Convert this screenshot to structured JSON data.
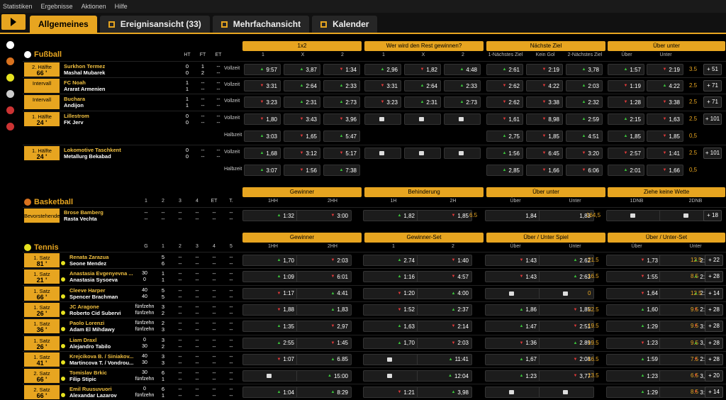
{
  "menu": [
    "Statistiken",
    "Ergebnisse",
    "Aktionen",
    "Hilfe"
  ],
  "tabs": [
    {
      "label": "Allgemeines",
      "active": true
    },
    {
      "label": "Ereignisansicht (33)"
    },
    {
      "label": "Mehrfachansicht"
    },
    {
      "label": "Kalender"
    }
  ],
  "football": {
    "title": "Fußball",
    "cols": [
      "HT",
      "FT",
      "ET"
    ],
    "markets": [
      "1x2",
      "Wer wird den Rest gewinnen?",
      "Nächste Ziel",
      "Über unter"
    ],
    "sub": [
      "1",
      "X",
      "2",
      "1",
      "X",
      "2",
      "1-Nächstes Ziel",
      "Kein Gol",
      "2-Nächstes Ziel",
      "Über",
      "Unter"
    ],
    "events": [
      {
        "s1": "2. Hälfte",
        "s2": "66 '",
        "h": "Surkhon Termez",
        "a": "Mashal Mubarek",
        "sc": [
          "0",
          "1",
          "--",
          "0",
          "2",
          "--"
        ],
        "lines": [
          {
            "l": "Vollzeit",
            "o": [
              "▲9:57",
              "▲3,87",
              "▼1:34",
              "▲2,96",
              "▼1,82",
              "▲4:48",
              "▲2:61",
              "▼2:19",
              "▲3,78",
              "▲1:57",
              "▼2:19"
            ],
            "x": "3.5",
            "p": "+ 51"
          }
        ]
      },
      {
        "s1": "Intervall",
        "s2": "",
        "h": "FC Noah",
        "a": "Ararat Armenien",
        "sc": [
          "1",
          "--",
          "--",
          "1",
          "--",
          "--"
        ],
        "lines": [
          {
            "l": "Vollzeit",
            "o": [
              "▼3:31",
              "▲2:64",
              "▲2:33",
              "▼3:31",
              "▲2:64",
              "▲2:33",
              "▼2:62",
              "▼4:22",
              "▲2:03",
              "▼1:19",
              "▲4:22"
            ],
            "x": "2.5",
            "p": "+ 71"
          }
        ]
      },
      {
        "s1": "Intervall",
        "s2": "",
        "h": "Buchara",
        "a": "Andijon",
        "sc": [
          "1",
          "--",
          "--",
          "1",
          "--",
          "--"
        ],
        "lines": [
          {
            "l": "Vollzeit",
            "o": [
              "▼3:23",
              "▲2:31",
              "▲2:73",
              "▼3:23",
              "▲2:31",
              "▲2:73",
              "▼2:62",
              "▼3:38",
              "▲2:32",
              "▼1:28",
              "▼3:38"
            ],
            "x": "2.5",
            "p": "+ 71"
          }
        ]
      },
      {
        "s1": "1. Hälfte",
        "s2": "24 '",
        "h": "Lillestrom",
        "a": "FK Jerv",
        "sc": [
          "0",
          "--",
          "--",
          "0",
          "--",
          "--"
        ],
        "lines": [
          {
            "l": "Vollzeit",
            "o": [
              "▼1,80",
              "▼3:43",
              "▼3,96",
              "L",
              "L",
              "L",
              "▼1,61",
              "▼8,98",
              "▲2:59",
              "▲2:15",
              "▼1,63"
            ],
            "x": "2.5",
            "p": "+ 101"
          },
          {
            "l": "Halbzeit",
            "o": [
              "▲3:03",
              "▼1,65",
              "▲5:47",
              "",
              "",
              "",
              "▲2,75",
              "▼1,85",
              "▲4:51",
              "▲1,85",
              "▼1,85"
            ],
            "x": "0,5",
            "p": ""
          }
        ]
      },
      {
        "s1": "1. Hälfte",
        "s2": "24 '",
        "h": "Lokomotive Taschkent",
        "a": "Metallurg Bekabad",
        "sc": [
          "0",
          "--",
          "--",
          "0",
          "--",
          "--"
        ],
        "lines": [
          {
            "l": "Vollzeit",
            "o": [
              "▲1,68",
              "▼3:12",
              "▼5:17",
              "L",
              "L",
              "L",
              "▲1:56",
              "▼6:45",
              "▼3:20",
              "▼2:57",
              "▼1:41"
            ],
            "x": "2.5",
            "p": "+ 101"
          },
          {
            "l": "Halbzeit",
            "o": [
              "▲3:07",
              "▼1:56",
              "▲7:38",
              "",
              "",
              "",
              "▲2,85",
              "▼1,66",
              "▼6:06",
              "▲2:01",
              "▼1,66"
            ],
            "x": "0,5",
            "p": ""
          }
        ]
      }
    ]
  },
  "basketball": {
    "title": "Basketball",
    "cols": [
      "1",
      "2",
      "3",
      "4",
      "ET",
      "T."
    ],
    "markets": [
      "Gewinner",
      "Behinderung",
      "Über unter",
      "Ziehe keine Wette"
    ],
    "sub": [
      "1HH",
      "2HH",
      "1H",
      "2H",
      "Über",
      "Unter",
      "1DNB",
      "2DNB"
    ],
    "event": {
      "s1": "Bevorstehende",
      "h": "Brose Bamberg",
      "a": "Rasta Vechta",
      "o": [
        "▲1:32",
        "▼3:00",
        "▲1,82",
        "▼1,85",
        "1,84",
        "1,83",
        "L",
        "L"
      ],
      "x1": "6.5",
      "x2": "164,5",
      "p": "+ 18"
    }
  },
  "tennis": {
    "title": "Tennis",
    "cols": [
      "G",
      "1",
      "2",
      "3",
      "4",
      "5"
    ],
    "markets": [
      "Gewinner",
      "Gewinner-Set",
      "Über / Unter Spiel",
      "Über / Unter-Set"
    ],
    "sub": [
      "1HH",
      "2HH",
      "1",
      "2",
      "Über",
      "Unter",
      "Über",
      "Unter"
    ],
    "events": [
      {
        "s1": "1. Satz",
        "s2": "81 '",
        "h": "Renata Zarazua",
        "a": "Seone Mendez",
        "g": [
          "",
          ""
        ],
        "set": [
          "5",
          "6"
        ],
        "o": [
          "▲1,70",
          "▼2:03",
          "▲2.74",
          "▼1:40",
          "▼1:43",
          "▲2.62",
          "▼1,73",
          "▲2:00"
        ],
        "x1": "21.5",
        "x2": "12.5",
        "p": "+ 22"
      },
      {
        "s1": "1. Satz",
        "s2": "21 '",
        "h": "Anastasia Evgenyevna ...",
        "a": "Anastasia Sysoeva",
        "g": [
          "30",
          "0"
        ],
        "set": [
          "1",
          "1"
        ],
        "o": [
          "▲1:09",
          "▼6:01",
          "▲1:16",
          "▼4:57",
          "▼1:43",
          "▲2:63",
          "▼1:55",
          "▲2:29"
        ],
        "x1": "16.5",
        "x2": "8.5",
        "p": "+ 28"
      },
      {
        "s1": "1. Satz",
        "s2": "66 '",
        "h": "Cleeve Harper",
        "a": "Spencer Brachman",
        "g": [
          "40",
          "40"
        ],
        "set": [
          "5",
          "5"
        ],
        "o": [
          "▼1:17",
          "▲4:41",
          "▼1:20",
          "▲4:00",
          "L",
          "L",
          "▼1,64",
          "▲2:13"
        ],
        "x1": "0",
        "x2": "12.5",
        "p": "+ 14"
      },
      {
        "s1": "1. Satz",
        "s2": "26 '",
        "h": "JC Aragone",
        "a": "Roberto Cid Subervi",
        "g": [
          "fünfzehn",
          "fünfzehn"
        ],
        "set": [
          "3",
          "2"
        ],
        "o": [
          "▼1,88",
          "▲1,83",
          "▼1:52",
          "▲2:37",
          "▲1,86",
          "▼1,85",
          "▲1,60",
          "▼2:20"
        ],
        "x1": "22.5",
        "x2": "9.5",
        "p": "+ 28"
      },
      {
        "s1": "1. Satz",
        "s2": "36 '",
        "h": "Paolo Lorenzi",
        "a": "Adam El Mihdawy",
        "g": [
          "fünfzehn",
          "fünfzehn"
        ],
        "set": [
          "2",
          "3"
        ],
        "o": [
          "▲1:35",
          "▼2,97",
          "▲1,63",
          "▼2:14",
          "▲1:47",
          "▼2:51",
          "▲1:29",
          "▼3:26"
        ],
        "x1": "19.5",
        "x2": "9.5",
        "p": "+ 28"
      },
      {
        "s1": "1. Satz",
        "s2": "26 '",
        "h": "Liam Draxl",
        "a": "Alejandro Tabilo",
        "g": [
          "0",
          "30"
        ],
        "set": [
          "3",
          "2"
        ],
        "o": [
          "▲2:55",
          "▼1:45",
          "▲1,70",
          "▼2:03",
          "▼1:36",
          "▲2.89",
          "▼1:23",
          "▲3,75"
        ],
        "x1": "19.5",
        "x2": "9.5",
        "p": "+ 28"
      },
      {
        "s1": "1. Satz",
        "s2": "41 '",
        "h": "Krejcikova B. / Siniakov...",
        "a": "Martincova T. / Vondrou...",
        "g": [
          "40",
          "30"
        ],
        "set": [
          "3",
          "3"
        ],
        "o": [
          "▼1:07",
          "▲6.85",
          "L",
          "▲11:41",
          "▲1,67",
          "▼2:08",
          "▲1:59",
          "▼2:22"
        ],
        "x1": "16.5",
        "x2": "7.5",
        "p": "+ 28"
      },
      {
        "s1": "2. Satz",
        "s2": "66 '",
        "h": "Tomislav Brkic",
        "a": "Filip Stipic",
        "g": [
          "30",
          "fünfzehn"
        ],
        "set": [
          "6",
          "1"
        ],
        "o": [
          "L",
          "▲15:00",
          "L",
          "▲12:04",
          "▲1:23",
          "▼3,77",
          "▲1:23",
          "▼3,77"
        ],
        "x1": "13.5",
        "x2": "6.5",
        "p": "+ 20"
      },
      {
        "s1": "2. Satz",
        "s2": "66 '",
        "h": "Emil Ruusuvuori",
        "a": "Alexandar Lazarov",
        "g": [
          "0",
          "fünfzehn"
        ],
        "set": [
          "6",
          "1"
        ],
        "o": [
          "▲1:04",
          "▲8:29",
          "▼1:21",
          "▲3,98",
          "L",
          "L",
          "▲1:29",
          "▼3:25"
        ],
        "x1": "",
        "x2": "8.5",
        "p": "+ 14"
      }
    ]
  }
}
